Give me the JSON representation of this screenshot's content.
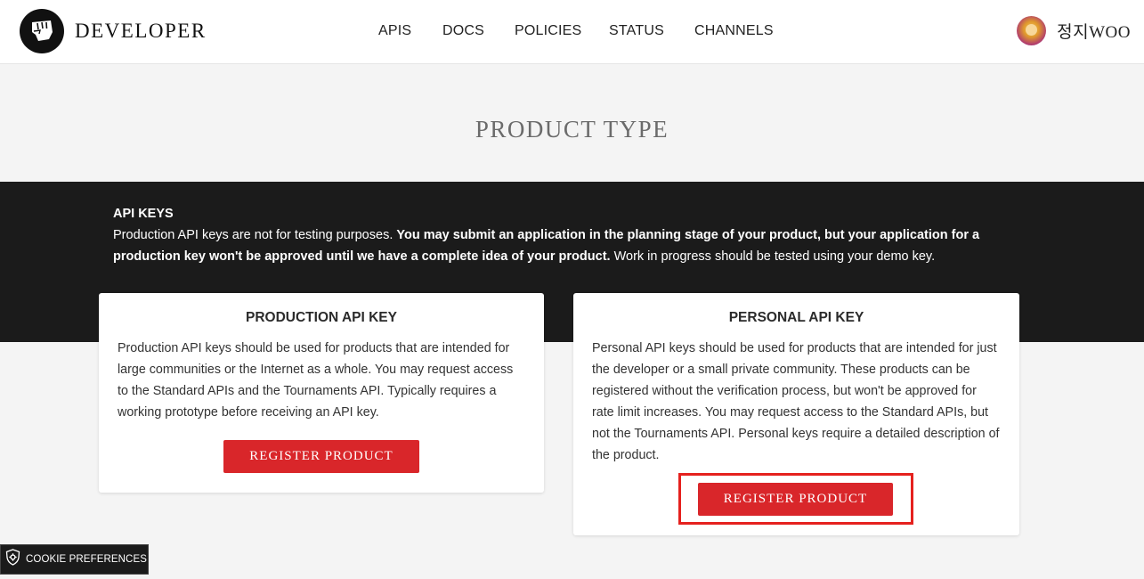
{
  "header": {
    "logo_text": "DEVELOPER",
    "nav": [
      "APIS",
      "DOCS",
      "POLICIES",
      "STATUS",
      "CHANNELS"
    ],
    "user_name": "정지WOO"
  },
  "page_title": "PRODUCT TYPE",
  "api_keys": {
    "heading": "API KEYS",
    "text_normal_1": "Production API keys are not for testing purposes. ",
    "text_bold": "You may submit an application in the planning stage of your product, but your application for a production key won't be approved until we have a complete idea of your product.",
    "text_normal_2": " Work in progress should be tested using your demo key."
  },
  "cards": {
    "production": {
      "title": "PRODUCTION API KEY",
      "body": "Production API keys should be used for products that are intended for large communities or the Internet as a whole. You may request access to the Standard APIs and the Tournaments API. Typically requires a working prototype before receiving an API key.",
      "button": "REGISTER PRODUCT"
    },
    "personal": {
      "title": "PERSONAL API KEY",
      "body": "Personal API keys should be used for products that are intended for just the developer or a small private community. These products can be registered without the verification process, but won't be approved for rate limit increases. You may request access to the Standard APIs, but not the Tournaments API. Personal keys require a detailed description of the product.",
      "button": "REGISTER PRODUCT"
    }
  },
  "cookie": {
    "label": "COOKIE PREFERENCES",
    "icon": "shield-gear-icon"
  },
  "colors": {
    "accent_red": "#d9262a",
    "dark_band": "#1b1b1b",
    "highlight": "#e5211e"
  }
}
